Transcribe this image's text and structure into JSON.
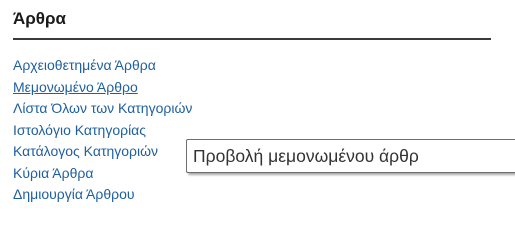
{
  "panel": {
    "title": "Άρθρα",
    "items": [
      {
        "label": "Αρχειοθετημένα Άρθρα",
        "active": false
      },
      {
        "label": "Μεμονωμένο Άρθρο",
        "active": true
      },
      {
        "label": "Λίστα Όλων των Κατηγοριών",
        "active": false
      },
      {
        "label": "Ιστολόγιο Κατηγορίας",
        "active": false
      },
      {
        "label": "Κατάλογος Κατηγοριών",
        "active": false
      },
      {
        "label": "Κύρια Άρθρα",
        "active": false
      },
      {
        "label": "Δημιουργία Άρθρου",
        "active": false
      }
    ]
  },
  "tooltip": {
    "text": "Προβολή μεμονωμένου άρθρ"
  },
  "colors": {
    "link": "#1f5f9f",
    "title": "#1a1a1a",
    "rule": "#3a3a3a",
    "tooltip_border": "#6e6e6e",
    "tooltip_text": "#333333"
  }
}
